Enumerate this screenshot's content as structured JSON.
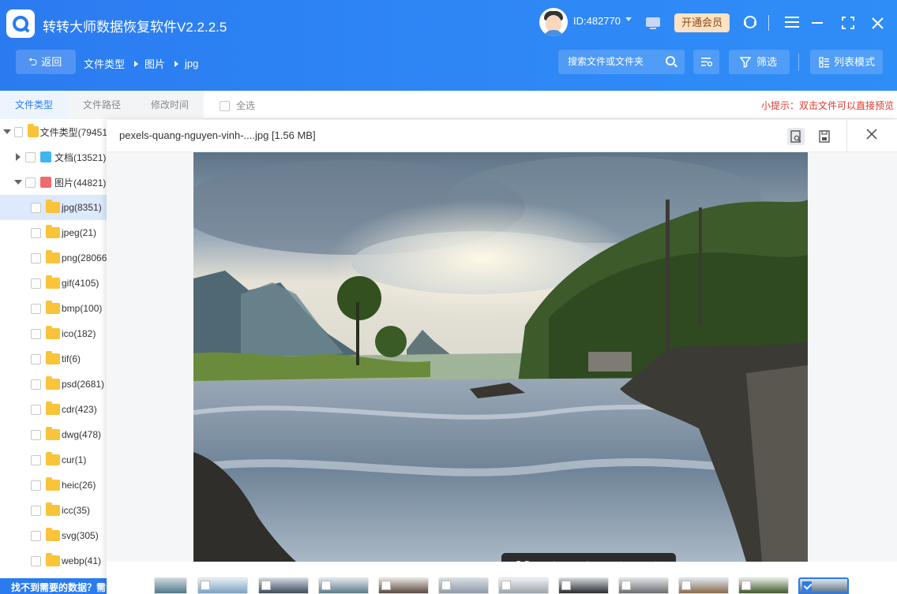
{
  "app": {
    "title": "转转大师数据恢复软件V2.2.2.5",
    "user_id": "ID:482770",
    "vip_label": "开通会员"
  },
  "nav": {
    "back_label": "返回",
    "breadcrumbs": [
      "文件类型",
      "图片",
      "jpg"
    ],
    "search_placeholder": "搜索文件或文件夹",
    "filter_label": "筛选",
    "view_label": "列表模式"
  },
  "tabs": [
    "文件类型",
    "文件路径",
    "修改时间"
  ],
  "select_all_label": "全选",
  "tip": "小提示：双击文件可以直接预览",
  "tree": {
    "root": "文件类型(79451)",
    "docs": "文档(13521)",
    "images": "图片(44821)",
    "types": [
      "jpg(8351)",
      "jpeg(21)",
      "png(28066)",
      "gif(4105)",
      "bmp(100)",
      "ico(182)",
      "tif(6)",
      "psd(2681)",
      "cdr(423)",
      "dwg(478)",
      "cur(1)",
      "heic(26)",
      "icc(35)",
      "svg(305)",
      "webp(41)"
    ]
  },
  "preview": {
    "file_title": "pexels-quang-nguyen-vinh-....jpg [1.56 MB]"
  },
  "bottom_hint": "找不到需要的数据？需",
  "colors": {
    "primary": "#2b7bf0",
    "tip": "#e0382e",
    "vip_bg": "#fde2c3",
    "folder": "#f9c33a"
  }
}
